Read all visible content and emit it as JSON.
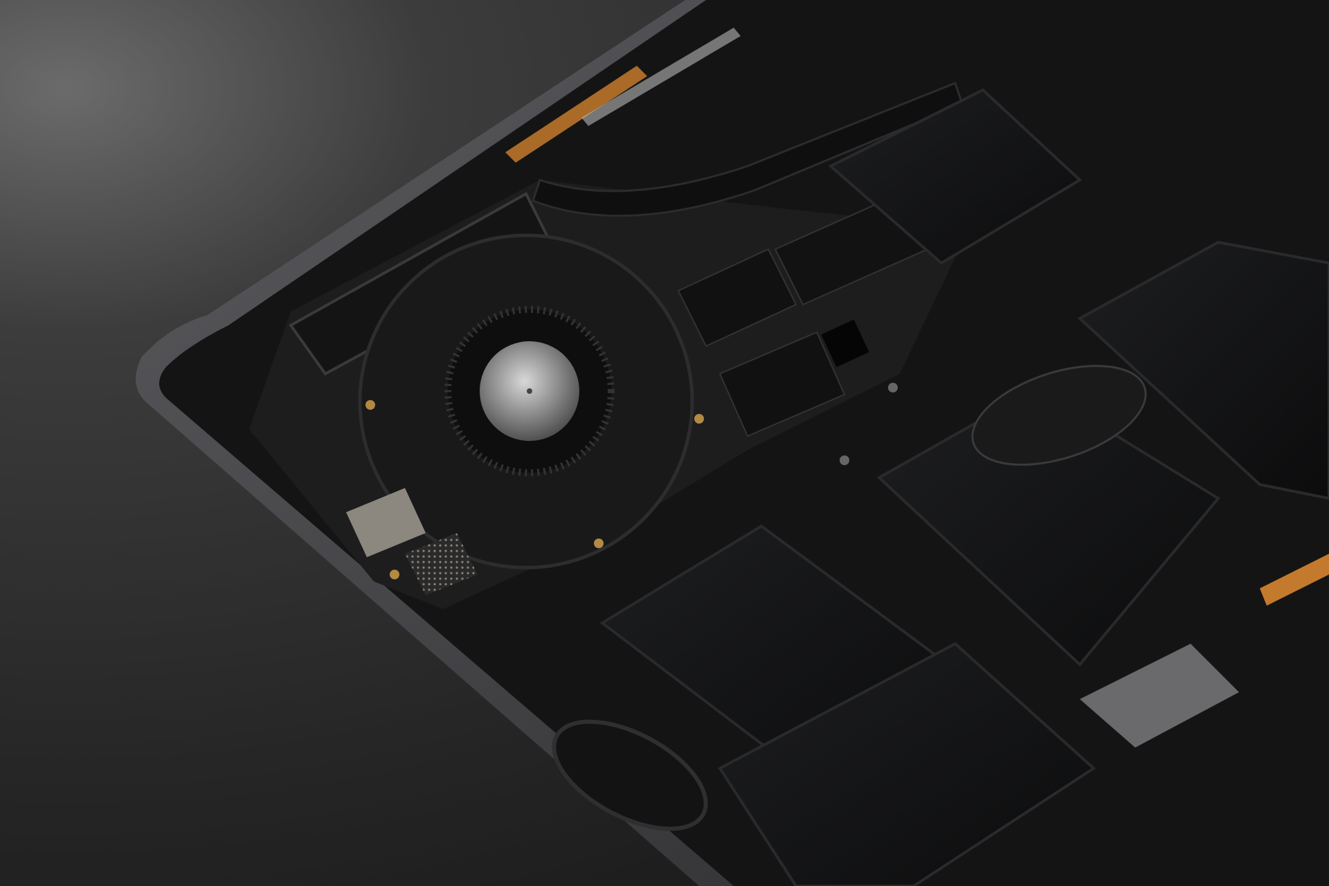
{
  "photo": {
    "subject": "laptop-internals",
    "colors": {
      "desk": "#2b2b2b",
      "desk_highlight": "#5a5a5a",
      "chassis_rim": "#4a4a4c",
      "chassis_inner": "#161616",
      "board": "#1c1c1c",
      "battery": "#111214",
      "copper_flex": "#c47a2c",
      "chip_silver": "#8c8880",
      "gold_pad": "#b38a42"
    }
  }
}
